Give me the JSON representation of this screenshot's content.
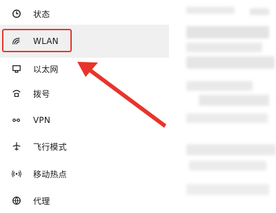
{
  "sidebar": {
    "items": [
      {
        "label": "状态",
        "icon": "status-icon"
      },
      {
        "label": "WLAN",
        "icon": "wifi-icon"
      },
      {
        "label": "以太网",
        "icon": "ethernet-icon"
      },
      {
        "label": "拨号",
        "icon": "dialup-icon"
      },
      {
        "label": "VPN",
        "icon": "vpn-icon"
      },
      {
        "label": "飞行模式",
        "icon": "airplane-icon"
      },
      {
        "label": "移动热点",
        "icon": "hotspot-icon"
      },
      {
        "label": "代理",
        "icon": "globe-icon"
      }
    ],
    "selected_index": 1
  },
  "colors": {
    "highlight_border": "#e8342b",
    "arrow": "#e8342b",
    "sidebar_bg": "#ffffff",
    "selected_bg": "#f0f0f0"
  }
}
